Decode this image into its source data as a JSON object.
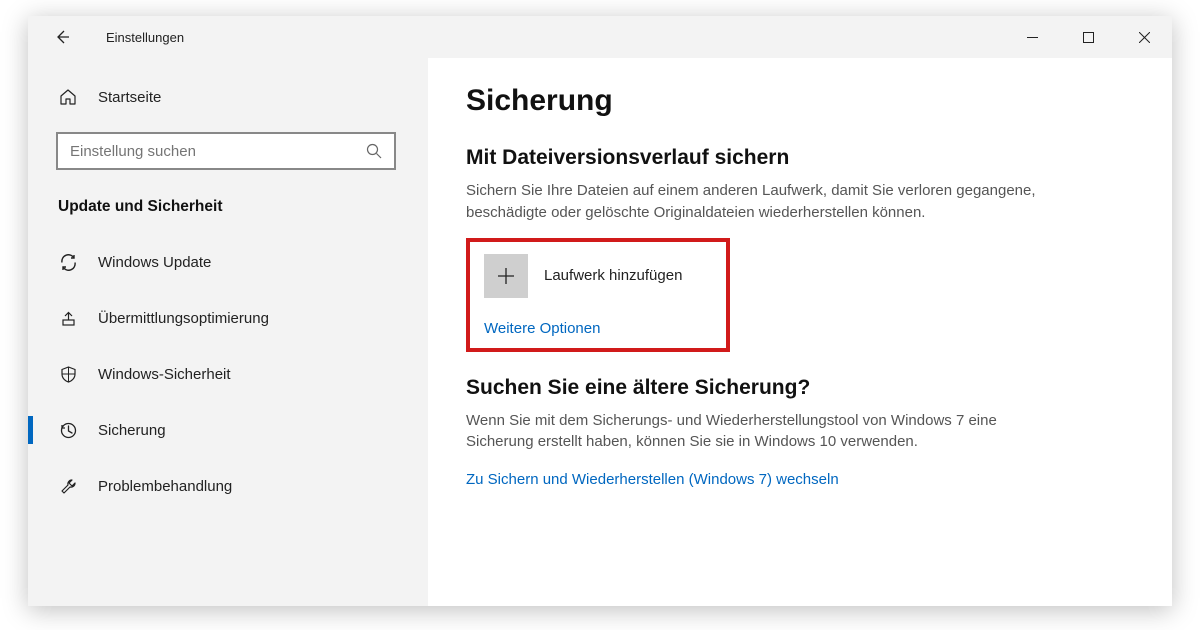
{
  "window": {
    "title": "Einstellungen"
  },
  "sidebar": {
    "home": "Startseite",
    "search_placeholder": "Einstellung suchen",
    "group_title": "Update und Sicherheit",
    "items": [
      {
        "label": "Windows Update",
        "icon": "sync"
      },
      {
        "label": "Übermittlungsoptimierung",
        "icon": "delivery"
      },
      {
        "label": "Windows-Sicherheit",
        "icon": "shield"
      },
      {
        "label": "Sicherung",
        "icon": "backup",
        "active": true
      },
      {
        "label": "Problembehandlung",
        "icon": "troubleshoot"
      }
    ]
  },
  "content": {
    "page_title": "Sicherung",
    "section1": {
      "title": "Mit Dateiversionsverlauf sichern",
      "desc": "Sichern Sie Ihre Dateien auf einem anderen Laufwerk, damit Sie verloren gegangene, beschädigte oder gelöschte Originaldateien wiederherstellen können.",
      "add_drive": "Laufwerk hinzufügen",
      "more_options": "Weitere Optionen"
    },
    "section2": {
      "title": "Suchen Sie eine ältere Sicherung?",
      "desc": "Wenn Sie mit dem Sicherungs- und Wiederherstellungstool von Windows 7 eine Sicherung erstellt haben, können Sie sie in Windows 10 verwenden.",
      "link": "Zu Sichern und Wiederherstellen (Windows 7) wechseln"
    }
  }
}
